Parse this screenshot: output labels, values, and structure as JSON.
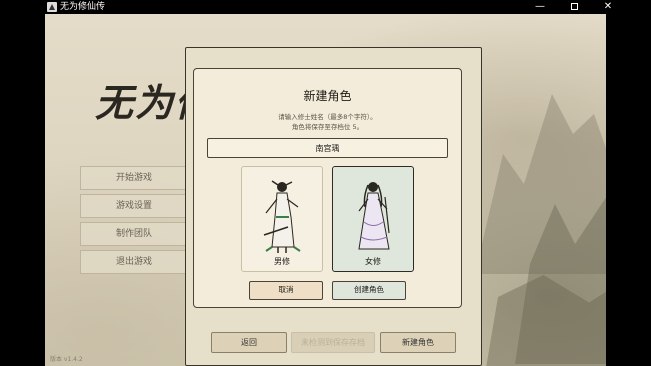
{
  "window": {
    "title": "无为修仙传",
    "minimize_glyph": "—",
    "close_glyph": "✕"
  },
  "game": {
    "logo": "无为修",
    "menu": [
      "开始游戏",
      "游戏设置",
      "制作团队",
      "退出游戏"
    ],
    "version": "版本 v1.4.2"
  },
  "outer_panel": {
    "back_label": "返回",
    "disabled_label": "未检测到保存存档",
    "create_label": "新建角色"
  },
  "modal": {
    "title": "新建角色",
    "hint_line1": "请输入修士姓名（最多8个字符）。",
    "hint_line2": "角色将保存至存档位 5。",
    "name_value": "南宫瑀",
    "cards": {
      "male_label": "男修",
      "female_label": "女修"
    },
    "selected_card": "female",
    "cancel_label": "取消",
    "confirm_label": "创建角色"
  },
  "colors": {
    "selected_card_bg": "#dfe7dc",
    "panel_bg": "#f3ecda",
    "border_dark": "#4b4336"
  },
  "icons": {
    "male_figure": "male-cultivator-figure",
    "female_figure": "female-cultivator-figure"
  }
}
